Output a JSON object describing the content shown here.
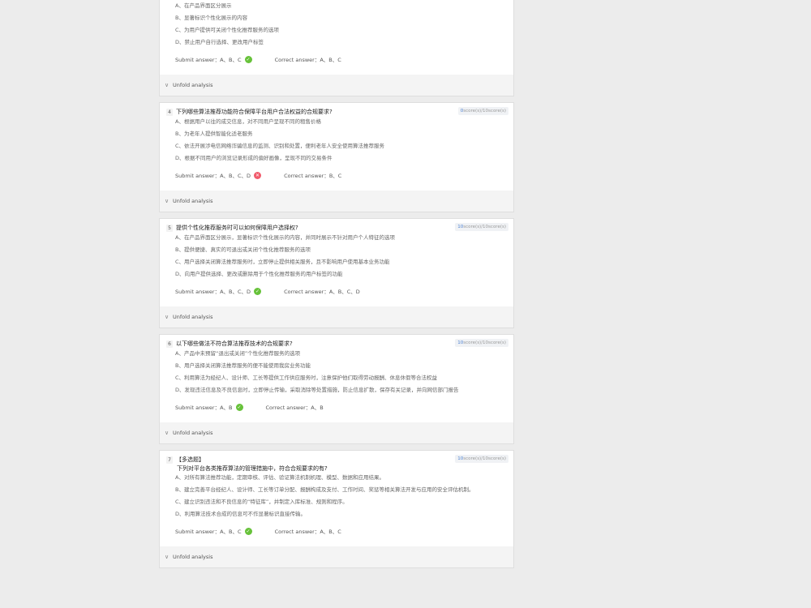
{
  "labels": {
    "submit_prefix": "Submit answer：",
    "correct_prefix": "Correct answer：",
    "unfold": "Unfold analysis",
    "score_suffix": "score(s)/10score(s)"
  },
  "questions": [
    {
      "number": "",
      "tag": "",
      "text": "",
      "score_got": "",
      "options": [
        "A、在产品界面区分展示",
        "B、显著标识个性化展示的内容",
        "C、为用户提供可关闭个性化推荐服务的选项",
        "D、禁止用户自行选择、更改用户标签"
      ],
      "submit": "A、B、C",
      "correct_answer": "A、B、C",
      "result": "correct"
    },
    {
      "number": "4",
      "tag": "",
      "text": "下列哪些算法推荐功能符合保障平台用户合法权益的合规要求?",
      "score_got": "0",
      "options": [
        "A、根据用户以往的成交信息，对不同用户呈现不同的租售价格",
        "B、为老年人提供智能化适老服务",
        "C、依法开展涉电信网络诈骗信息的监测、识别和处置，便利老年人安全使用算法推荐服务",
        "D、根据不同用户的浏览记录形成的偏好画像，呈现不同的交易条件"
      ],
      "submit": "A、B、C、D",
      "correct_answer": "B、C",
      "result": "wrong"
    },
    {
      "number": "5",
      "tag": "",
      "text": "提供个性化推荐服务时可以如何保障用户选择权?",
      "score_got": "10",
      "options": [
        "A、在产品界面区分展示，显著标识个性化展示的内容，并同时展示不针对用户个人特征的选项",
        "B、提供便捷、真实的可退出或关闭个性化推荐服务的选项",
        "C、用户选择关闭算法推荐服务时，立即停止提供相关服务，且不影响用户使用基本业务功能",
        "D、向用户提供选择、更改或删除用于个性化推荐服务的用户标签的功能"
      ],
      "submit": "A、B、C、D",
      "correct_answer": "A、B、C、D",
      "result": "correct"
    },
    {
      "number": "6",
      "tag": "",
      "text": "以下哪些做法不符合算法推荐技术的合规要求?",
      "score_got": "10",
      "options": [
        "A、产品中未预留“退出或关闭”个性化推荐服务的选项",
        "B、用户选择关闭算法推荐服务的便不能使用我房业务功能",
        "C、利用算法为经纪人、设计师、工长等提供工作供应服务时，注意保护他们取得劳动报酬、休息休假等合法权益",
        "D、发现违法信息及不良信息时，立即停止传输，采取消除等处置措施，防止信息扩散，保存有关记录，并向网信部门报告"
      ],
      "submit": "A、B",
      "correct_answer": "A、B",
      "result": "correct"
    },
    {
      "number": "7",
      "tag": "【多选题】",
      "text": "下列对平台各类推荐算法的管理措施中，符合合规要求的有?",
      "score_got": "10",
      "options": [
        "A、对所有算法推荐功能，定期审核、评估、验证算法机制机理、模型、数据和应用结果。",
        "B、建立完善平台经纪人、设计师、工长等订单分配、报酬构成及支付、工作时间、奖惩等相关算法开发与应用的安全评估机制。",
        "C、建立识别违法和不良信息的“特征库”，并制定入库标准、规则和程序。",
        "D、利用算法技术合成的信息可不作显著标识直接传输。"
      ],
      "submit": "A、B、C",
      "correct_answer": "A、B、C",
      "result": "correct"
    }
  ]
}
